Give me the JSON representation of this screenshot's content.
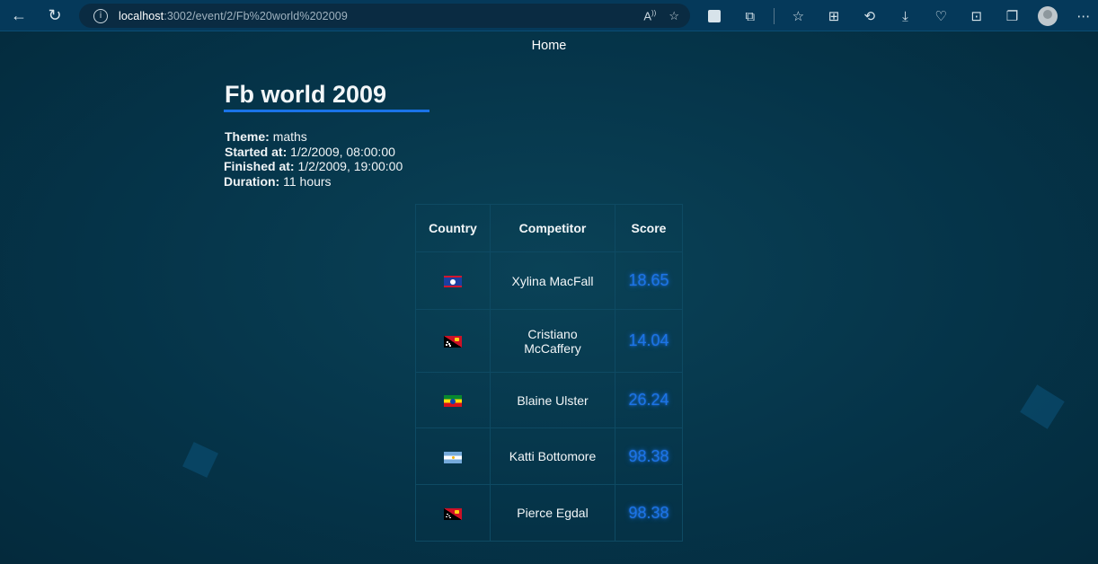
{
  "browser": {
    "url_host": "localhost",
    "url_rest": ":3002/event/2/Fb%20world%202009"
  },
  "nav": {
    "home_label": "Home"
  },
  "event": {
    "title": "Fb world 2009",
    "theme_label": "Theme:",
    "theme": "maths",
    "started_label": "Started at:",
    "started": "1/2/2009, 08:00:00",
    "finished_label": "Finished at:",
    "finished": "1/2/2009, 19:00:00",
    "duration_label": "Duration:",
    "duration": "11 hours"
  },
  "table": {
    "headers": [
      "Country",
      "Competitor",
      "Score"
    ],
    "rows": [
      {
        "flag": "belize-flag",
        "competitor": "Xylina MacFall",
        "score": "18.65"
      },
      {
        "flag": "papua-new-guinea-flag",
        "competitor": "Cristiano McCaffery",
        "score": "14.04"
      },
      {
        "flag": "ethiopia-flag",
        "competitor": "Blaine Ulster",
        "score": "26.24"
      },
      {
        "flag": "argentina-flag",
        "competitor": "Katti Bottomore",
        "score": "98.38"
      },
      {
        "flag": "papua-new-guinea-flag",
        "competitor": "Pierce Egdal",
        "score": "98.38"
      }
    ]
  },
  "colors": {
    "accent": "#1a73e8",
    "score": "#1d74e6",
    "background": "#053449"
  }
}
